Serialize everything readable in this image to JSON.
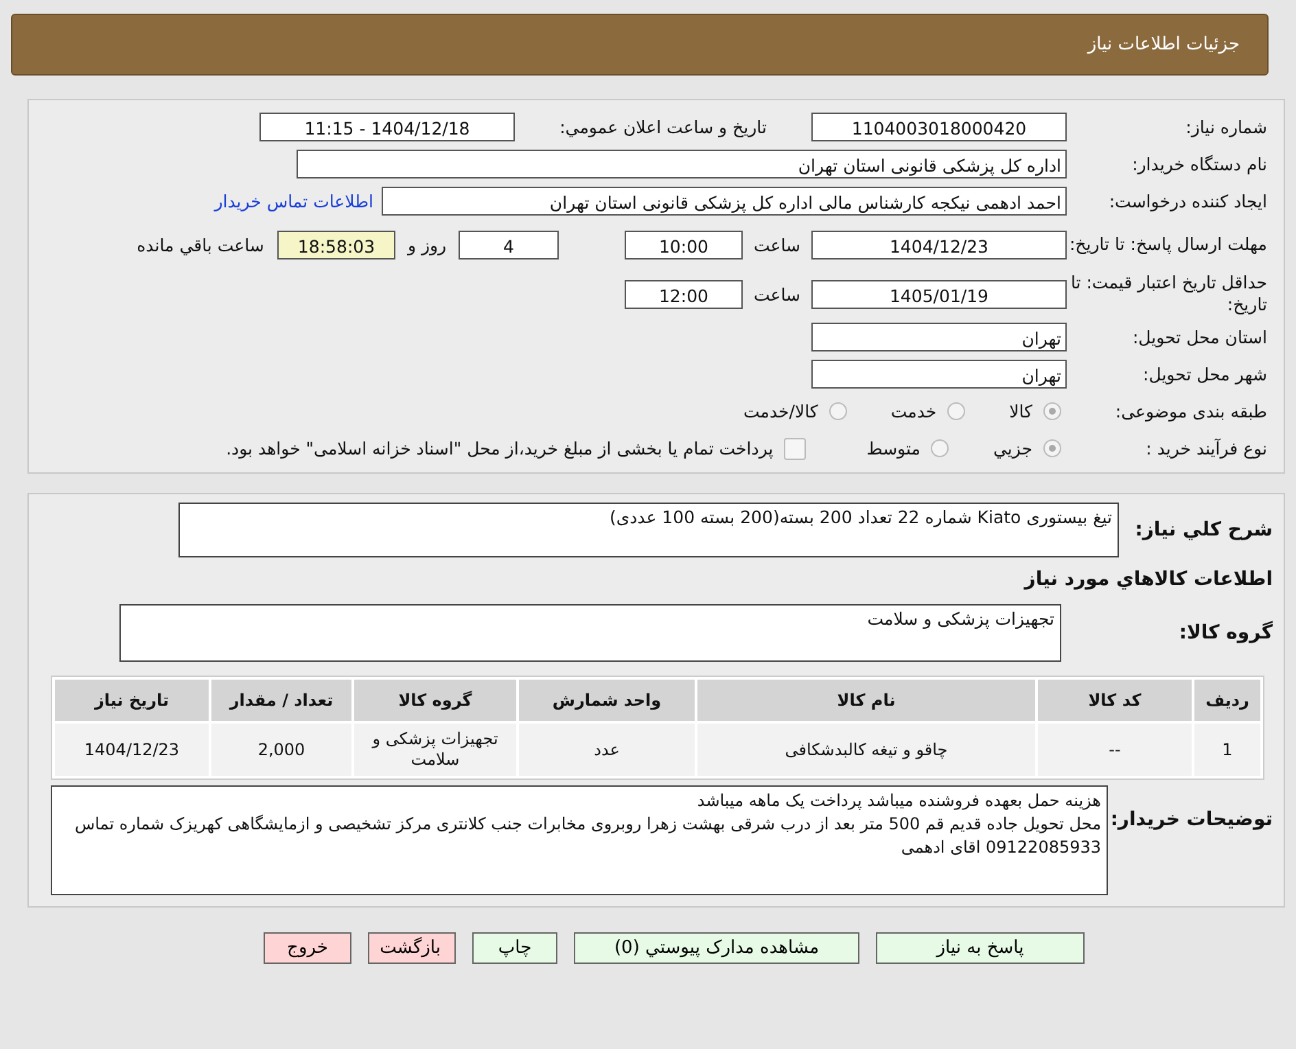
{
  "header": {
    "title": "جزئیات اطلاعات نیاز"
  },
  "need_number": {
    "label": "شماره نیاز:",
    "value": "1104003018000420"
  },
  "announce": {
    "label": "تاریخ و ساعت اعلان عمومي:",
    "value": "1404/12/18 - 11:15"
  },
  "buyer_org": {
    "label": "نام دستگاه خریدار:",
    "value": "اداره کل پزشکی قانونی استان تهران"
  },
  "requester": {
    "label": "ایجاد کننده درخواست:",
    "value": "احمد ادهمی نیکجه کارشناس مالی اداره کل پزشکی قانونی استان تهران",
    "link": "اطلاعات تماس خریدار"
  },
  "reply_deadline": {
    "label": "مهلت ارسال پاسخ: تا تاریخ:",
    "date": "1404/12/23",
    "time_label": "ساعت",
    "time": "10:00",
    "days": "4",
    "days_label": "روز و",
    "remaining": "18:58:03",
    "remaining_label": "ساعت باقي مانده"
  },
  "validity": {
    "label": "حداقل تاریخ اعتبار قیمت: تا تاریخ:",
    "date": "1405/01/19",
    "time_label": "ساعت",
    "time": "12:00"
  },
  "province": {
    "label": "استان محل تحویل:",
    "value": "تهران"
  },
  "city": {
    "label": "شهر محل تحویل:",
    "value": "تهران"
  },
  "category": {
    "label": "طبقه بندی موضوعی:",
    "options": [
      {
        "label": "کالا",
        "selected": true
      },
      {
        "label": "خدمت",
        "selected": false
      },
      {
        "label": "کالا/خدمت",
        "selected": false
      }
    ]
  },
  "process": {
    "label": "نوع فرآیند خرید :",
    "options": [
      {
        "label": "جزيي",
        "selected": true
      },
      {
        "label": "متوسط",
        "selected": false
      }
    ],
    "payment": {
      "checked": false,
      "label": "پرداخت تمام یا بخشی از مبلغ خرید،از محل \"اسناد خزانه اسلامی\" خواهد بود."
    }
  },
  "description": {
    "label": "شرح کلي نياز:",
    "value": "تیغ بیستوری Kiato شماره 22 تعداد 200 بسته(200 بسته 100 عددی)"
  },
  "goods_title": "اطلاعات کالاهاي مورد نياز",
  "goods_group": {
    "label": "گروه کالا:",
    "value": "تجهیزات پزشکی و سلامت"
  },
  "table": {
    "columns": [
      "رديف",
      "کد کالا",
      "نام کالا",
      "واحد شمارش",
      "گروه کالا",
      "تعداد / مقدار",
      "تاریخ نیاز"
    ],
    "rows": [
      [
        "1",
        "--",
        "چاقو و تیغه کالبدشکافی",
        "عدد",
        "تجهیزات پزشکی و سلامت",
        "2,000",
        "1404/12/23"
      ]
    ]
  },
  "buyer_notes": {
    "label": "توضیحات خریدار:",
    "lines": [
      "هزینه حمل بعهده فروشنده میباشد پرداخت یک ماهه میباشد",
      "محل تحویل جاده قدیم قم 500 متر بعد از درب شرقی بهشت زهرا روبروی مخابرات جنب کلانتری مرکز تشخیصی و ازمایشگاهی کهریزک شماره تماس 09122085933 اقای ادهمی"
    ]
  },
  "buttons": [
    {
      "label": "پاسخ به نياز",
      "kind": "action"
    },
    {
      "label": "مشاهده مدارک پیوستي (0)",
      "kind": "action"
    },
    {
      "label": "چاپ",
      "kind": "action"
    },
    {
      "label": "بازگشت",
      "kind": "exit"
    },
    {
      "label": "خروج",
      "kind": "exit"
    }
  ]
}
